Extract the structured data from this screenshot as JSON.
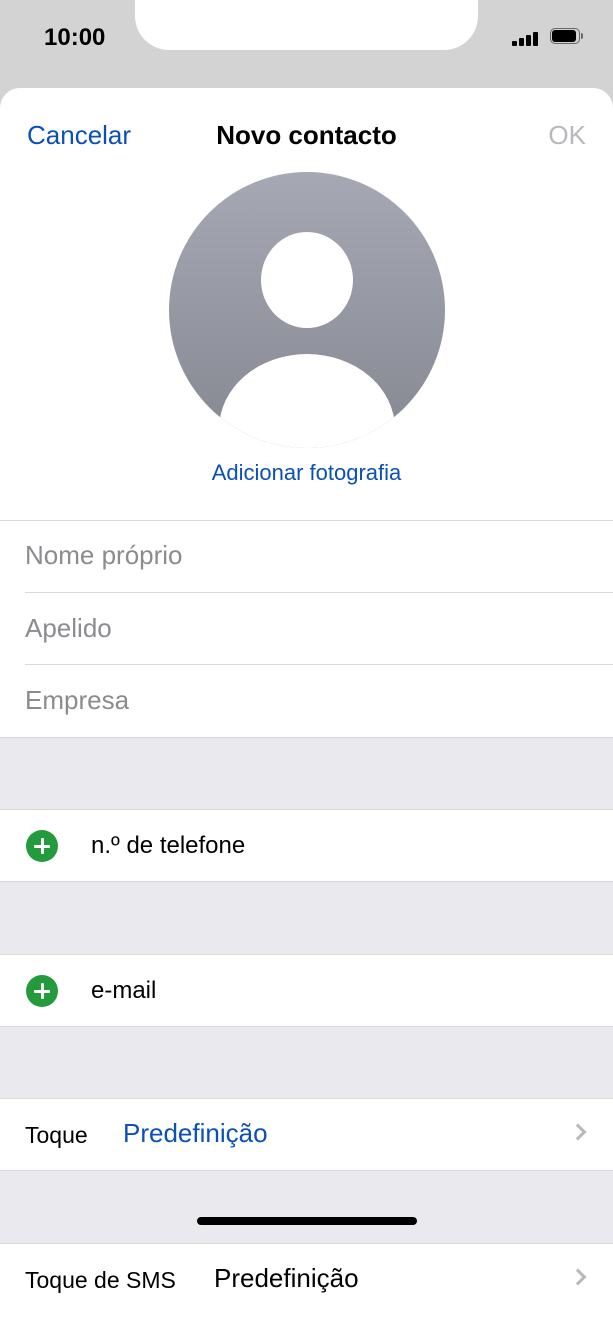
{
  "status_bar": {
    "time": "10:00",
    "signal_icon": "cellular-signal-icon",
    "battery_icon": "battery-icon"
  },
  "nav": {
    "cancel": "Cancelar",
    "title": "Novo contacto",
    "ok": "OK"
  },
  "photo": {
    "avatar_icon": "person-silhouette-icon",
    "add_label": "Adicionar fotografia"
  },
  "fields": {
    "first_name": {
      "placeholder": "Nome próprio",
      "value": ""
    },
    "last_name": {
      "placeholder": "Apelido",
      "value": ""
    },
    "company": {
      "placeholder": "Empresa",
      "value": ""
    }
  },
  "add_rows": {
    "phone": "n.º de telefone",
    "email": "e-mail"
  },
  "ringtone": {
    "label": "Toque",
    "value": "Predefinição"
  },
  "sms_tone": {
    "label": "Toque de SMS",
    "value": "Predefinição"
  },
  "colors": {
    "accent": "#0a50b8",
    "add_green": "#239b3c",
    "separator_bg": "#e9e9ee",
    "disabled": "#b8b8bc"
  }
}
